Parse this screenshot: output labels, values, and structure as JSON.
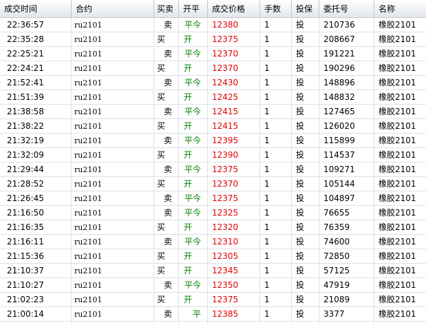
{
  "headers": {
    "time": "成交时间",
    "contract": "合约",
    "buysell": "买卖",
    "openclose": "开平",
    "price": "成交价格",
    "qty": "手数",
    "hedge": "投保",
    "order": "委托号",
    "name": "名称"
  },
  "rows": [
    {
      "time": "22:36:57",
      "contract": "ru2101",
      "side": "卖",
      "oc": "平今",
      "price": "12380",
      "qty": "1",
      "hedge": "投",
      "order": "210736",
      "name": "橡胶2101"
    },
    {
      "time": "22:35:28",
      "contract": "ru2101",
      "side": "买",
      "oc": "开",
      "price": "12375",
      "qty": "1",
      "hedge": "投",
      "order": "208667",
      "name": "橡胶2101"
    },
    {
      "time": "22:25:21",
      "contract": "ru2101",
      "side": "卖",
      "oc": "平今",
      "price": "12370",
      "qty": "1",
      "hedge": "投",
      "order": "191221",
      "name": "橡胶2101"
    },
    {
      "time": "22:24:21",
      "contract": "ru2101",
      "side": "买",
      "oc": "开",
      "price": "12370",
      "qty": "1",
      "hedge": "投",
      "order": "190296",
      "name": "橡胶2101"
    },
    {
      "time": "21:52:41",
      "contract": "ru2101",
      "side": "卖",
      "oc": "平今",
      "price": "12430",
      "qty": "1",
      "hedge": "投",
      "order": "148896",
      "name": "橡胶2101"
    },
    {
      "time": "21:51:39",
      "contract": "ru2101",
      "side": "买",
      "oc": "开",
      "price": "12425",
      "qty": "1",
      "hedge": "投",
      "order": "148832",
      "name": "橡胶2101"
    },
    {
      "time": "21:38:58",
      "contract": "ru2101",
      "side": "卖",
      "oc": "平今",
      "price": "12415",
      "qty": "1",
      "hedge": "投",
      "order": "127465",
      "name": "橡胶2101"
    },
    {
      "time": "21:38:22",
      "contract": "ru2101",
      "side": "买",
      "oc": "开",
      "price": "12415",
      "qty": "1",
      "hedge": "投",
      "order": "126020",
      "name": "橡胶2101"
    },
    {
      "time": "21:32:19",
      "contract": "ru2101",
      "side": "卖",
      "oc": "平今",
      "price": "12395",
      "qty": "1",
      "hedge": "投",
      "order": "115899",
      "name": "橡胶2101"
    },
    {
      "time": "21:32:09",
      "contract": "ru2101",
      "side": "买",
      "oc": "开",
      "price": "12390",
      "qty": "1",
      "hedge": "投",
      "order": "114537",
      "name": "橡胶2101"
    },
    {
      "time": "21:29:44",
      "contract": "ru2101",
      "side": "卖",
      "oc": "平今",
      "price": "12375",
      "qty": "1",
      "hedge": "投",
      "order": "109271",
      "name": "橡胶2101"
    },
    {
      "time": "21:28:52",
      "contract": "ru2101",
      "side": "买",
      "oc": "开",
      "price": "12370",
      "qty": "1",
      "hedge": "投",
      "order": "105144",
      "name": "橡胶2101"
    },
    {
      "time": "21:26:45",
      "contract": "ru2101",
      "side": "卖",
      "oc": "平今",
      "price": "12375",
      "qty": "1",
      "hedge": "投",
      "order": "104897",
      "name": "橡胶2101"
    },
    {
      "time": "21:16:50",
      "contract": "ru2101",
      "side": "卖",
      "oc": "平今",
      "price": "12325",
      "qty": "1",
      "hedge": "投",
      "order": "76655",
      "name": "橡胶2101"
    },
    {
      "time": "21:16:35",
      "contract": "ru2101",
      "side": "买",
      "oc": "开",
      "price": "12320",
      "qty": "1",
      "hedge": "投",
      "order": "76359",
      "name": "橡胶2101"
    },
    {
      "time": "21:16:11",
      "contract": "ru2101",
      "side": "卖",
      "oc": "平今",
      "price": "12310",
      "qty": "1",
      "hedge": "投",
      "order": "74600",
      "name": "橡胶2101"
    },
    {
      "time": "21:15:36",
      "contract": "ru2101",
      "side": "买",
      "oc": "开",
      "price": "12305",
      "qty": "1",
      "hedge": "投",
      "order": "72850",
      "name": "橡胶2101"
    },
    {
      "time": "21:10:37",
      "contract": "ru2101",
      "side": "买",
      "oc": "开",
      "price": "12345",
      "qty": "1",
      "hedge": "投",
      "order": "57125",
      "name": "橡胶2101"
    },
    {
      "time": "21:10:27",
      "contract": "ru2101",
      "side": "卖",
      "oc": "平今",
      "price": "12350",
      "qty": "1",
      "hedge": "投",
      "order": "47919",
      "name": "橡胶2101"
    },
    {
      "time": "21:02:23",
      "contract": "ru2101",
      "side": "买",
      "oc": "开",
      "price": "12375",
      "qty": "1",
      "hedge": "投",
      "order": "21089",
      "name": "橡胶2101"
    },
    {
      "time": "21:00:14",
      "contract": "ru2101",
      "side": "卖",
      "oc": "平",
      "price": "12385",
      "qty": "1",
      "hedge": "投",
      "order": "3377",
      "name": "橡胶2101"
    }
  ]
}
